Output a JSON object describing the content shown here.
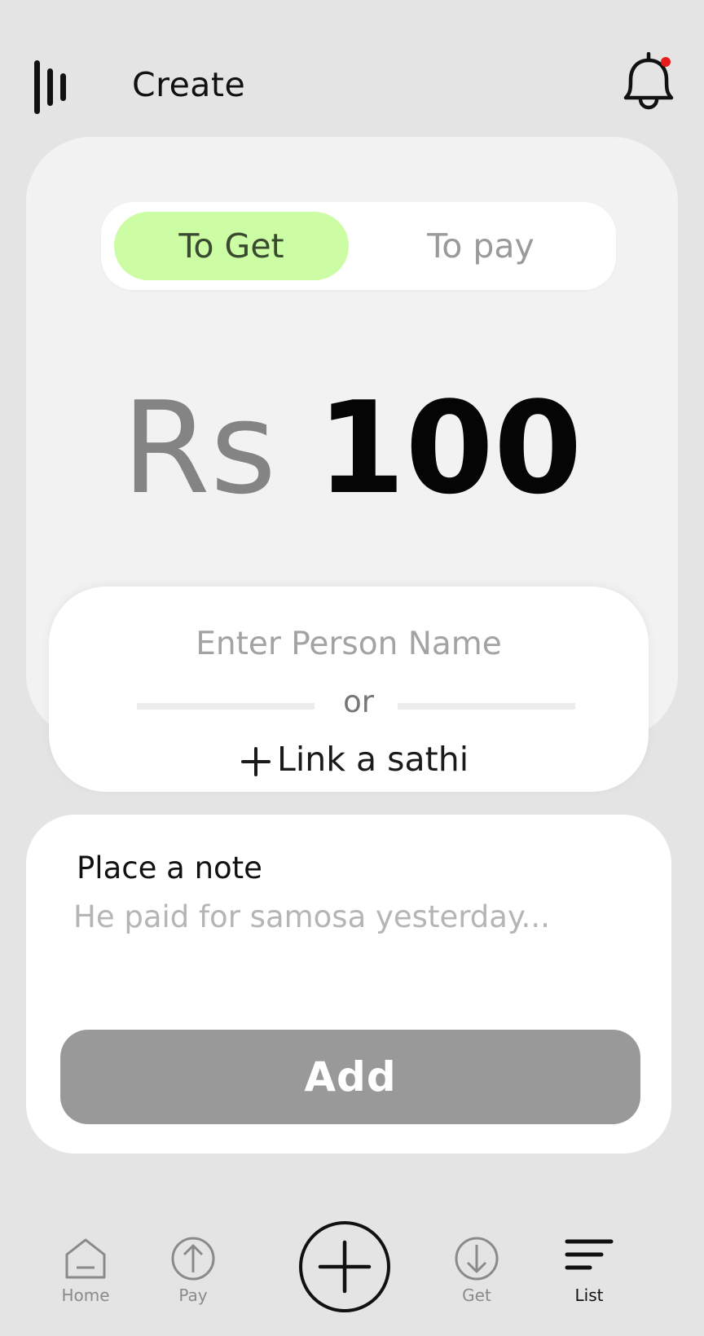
{
  "header": {
    "title": "Create",
    "notification_dot_color": "#e81c1c"
  },
  "toggle": {
    "get_label": "To Get",
    "pay_label": "To pay",
    "active": "To Get",
    "active_color": "#ccfca3"
  },
  "amount": {
    "currency": "Rs",
    "value": "100"
  },
  "person": {
    "placeholder": "Enter Person Name",
    "or_label": "or",
    "link_label": "Link a sathi"
  },
  "note": {
    "label": "Place a note",
    "placeholder": "He paid for samosa yesterday..."
  },
  "add_button": {
    "label": "Add"
  },
  "nav": {
    "items": [
      {
        "label": "Home",
        "icon": "home-icon"
      },
      {
        "label": "Pay",
        "icon": "arrow-up-circle-icon"
      },
      {
        "label": "",
        "icon": "plus-circle-icon"
      },
      {
        "label": "Get",
        "icon": "arrow-down-circle-icon"
      },
      {
        "label": "List",
        "icon": "list-icon"
      }
    ],
    "active": "List"
  }
}
